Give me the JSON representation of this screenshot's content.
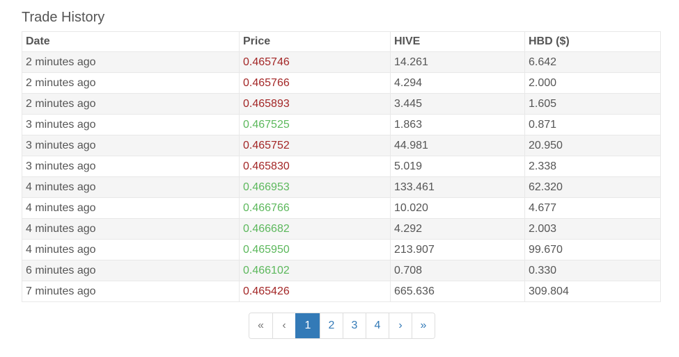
{
  "title": "Trade History",
  "colors": {
    "price_down": "#a32626",
    "price_up": "#5cb85c",
    "accent": "#337ab7"
  },
  "table": {
    "headers": [
      "Date",
      "Price",
      "HIVE",
      "HBD ($)"
    ],
    "rows": [
      {
        "date": "2 minutes ago",
        "price": "0.465746",
        "dir": "down",
        "hive": "14.261",
        "hbd": "6.642"
      },
      {
        "date": "2 minutes ago",
        "price": "0.465766",
        "dir": "down",
        "hive": "4.294",
        "hbd": "2.000"
      },
      {
        "date": "2 minutes ago",
        "price": "0.465893",
        "dir": "down",
        "hive": "3.445",
        "hbd": "1.605"
      },
      {
        "date": "3 minutes ago",
        "price": "0.467525",
        "dir": "up",
        "hive": "1.863",
        "hbd": "0.871"
      },
      {
        "date": "3 minutes ago",
        "price": "0.465752",
        "dir": "down",
        "hive": "44.981",
        "hbd": "20.950"
      },
      {
        "date": "3 minutes ago",
        "price": "0.465830",
        "dir": "down",
        "hive": "5.019",
        "hbd": "2.338"
      },
      {
        "date": "4 minutes ago",
        "price": "0.466953",
        "dir": "up",
        "hive": "133.461",
        "hbd": "62.320"
      },
      {
        "date": "4 minutes ago",
        "price": "0.466766",
        "dir": "up",
        "hive": "10.020",
        "hbd": "4.677"
      },
      {
        "date": "4 minutes ago",
        "price": "0.466682",
        "dir": "up",
        "hive": "4.292",
        "hbd": "2.003"
      },
      {
        "date": "4 minutes ago",
        "price": "0.465950",
        "dir": "up",
        "hive": "213.907",
        "hbd": "99.670"
      },
      {
        "date": "6 minutes ago",
        "price": "0.466102",
        "dir": "up",
        "hive": "0.708",
        "hbd": "0.330"
      },
      {
        "date": "7 minutes ago",
        "price": "0.465426",
        "dir": "down",
        "hive": "665.636",
        "hbd": "309.804"
      }
    ]
  },
  "pagination": {
    "first": "«",
    "prev": "‹",
    "pages": [
      "1",
      "2",
      "3",
      "4"
    ],
    "active_page": "1",
    "next": "›",
    "last": "»"
  }
}
